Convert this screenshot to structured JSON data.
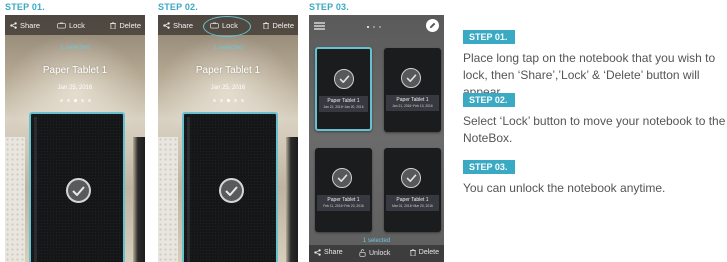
{
  "steps": [
    {
      "label": "STEP 01."
    },
    {
      "label": "STEP 02."
    },
    {
      "label": "STEP 03."
    }
  ],
  "phone1": {
    "toolbar": {
      "share": "Share",
      "lock": "Lock",
      "delete": "Delete"
    },
    "selected": "1 selected",
    "notebook_title": "Paper Tablet 1",
    "notebook_date": "Jan 25, 2016"
  },
  "phone2": {
    "toolbar": {
      "share": "Share",
      "lock": "Lock",
      "delete": "Delete"
    },
    "selected": "1 selected",
    "notebook_title": "Paper Tablet 1",
    "notebook_date": "Jan 25, 2016"
  },
  "phone3": {
    "tiles": [
      {
        "title": "Paper Tablet 1",
        "date": "Jan 21, 2016~Jan 20, 2016"
      },
      {
        "title": "Paper Tablet 1",
        "date": "Jan 21, 2016~Feb 10, 2016"
      },
      {
        "title": "Paper Tablet 1",
        "date": "Feb 11, 2016~Feb 20, 2016"
      },
      {
        "title": "Paper Tablet 1",
        "date": "Mar 01, 2016~Mar 20, 2016"
      }
    ],
    "selected": "1 selected",
    "toolbar": {
      "share": "Share",
      "unlock": "Unlock",
      "delete": "Delete"
    }
  },
  "instructions": [
    {
      "badge": "STEP 01.",
      "text": "Place long tap on the notebook that you wish to lock, then ‘Share’,’Lock’ & ‘Delete’ button will appear."
    },
    {
      "badge": "STEP 02.",
      "text": "Select ‘Lock’ button to move your notebook to the NoteBox."
    },
    {
      "badge": "STEP 03.",
      "text": "You can unlock the notebook anytime."
    }
  ],
  "colors": {
    "accent": "#3aa9c4",
    "selection_outline": "#67c1cf",
    "body_text": "#555555"
  }
}
